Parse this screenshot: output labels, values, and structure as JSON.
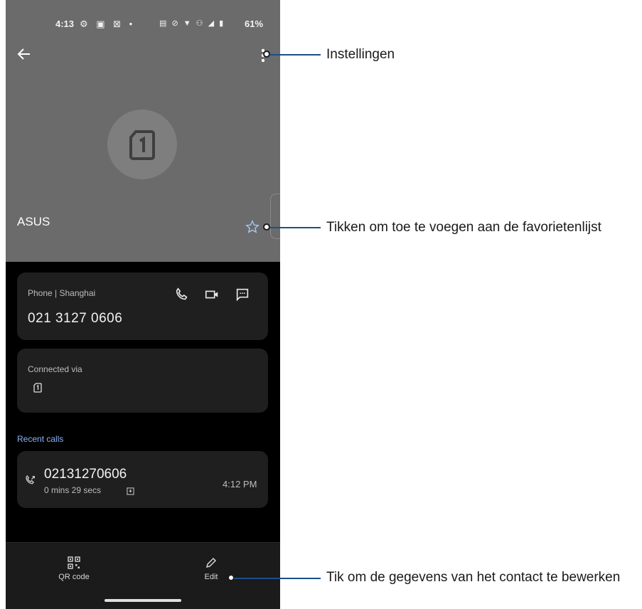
{
  "status_bar": {
    "time": "4:13",
    "left_icons": "⚙ ▣ ⊠ •",
    "right_icons": "▤ ⊘ ▼ ⚇ ◢ ▮",
    "battery": "61%"
  },
  "contact": {
    "name": "ASUS",
    "avatar_icon": "sim-card-icon"
  },
  "phone_card": {
    "label": "Phone | Shanghai",
    "number": "021 3127 0606",
    "actions": [
      "call-icon",
      "video-call-icon",
      "message-icon"
    ]
  },
  "connected_card": {
    "label": "Connected via",
    "sim_number": "1"
  },
  "recent_calls": {
    "title": "Recent calls",
    "items": [
      {
        "number": "02131270606",
        "duration": "0 mins 29 secs",
        "time": "4:12 PM"
      }
    ]
  },
  "bottom_bar": {
    "qr_label": "QR code",
    "edit_label": "Edit"
  },
  "callouts": {
    "settings": "Instellingen",
    "favorite": "Tikken om toe te voegen aan de favorietenlijst",
    "edit": "Tik om de gegevens van het contact te bewerken"
  },
  "colors": {
    "header_bg": "#6b6b6b",
    "card_bg": "#1f1f1f",
    "accent_blue": "#8ab4f8",
    "callout_line": "#1a4f8a"
  }
}
